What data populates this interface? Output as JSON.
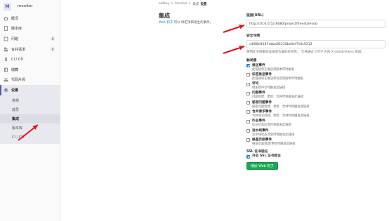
{
  "project": {
    "avatar_letter": "M",
    "name": "monitor"
  },
  "sidebar": {
    "items": [
      {
        "label": "概况",
        "icon": "home-icon"
      },
      {
        "label": "版本库",
        "icon": "doc-icon"
      },
      {
        "label": "问题",
        "icon": "issues-icon",
        "badge": "0"
      },
      {
        "label": "合并请求",
        "icon": "merge-request-icon",
        "badge": "0"
      },
      {
        "label": "CI / CD",
        "icon": "rocket-icon"
      },
      {
        "label": "储藏",
        "icon": "book-icon"
      },
      {
        "label": "代码片段",
        "icon": "scissors-icon"
      },
      {
        "label": "设置",
        "icon": "gear-icon"
      }
    ],
    "sub_items": [
      {
        "label": "常规"
      },
      {
        "label": "成员"
      },
      {
        "label": "集成"
      },
      {
        "label": "版本库"
      },
      {
        "label": "CI / CD"
      }
    ]
  },
  "breadcrumb": {
    "items": [
      "oldboy",
      "monitor",
      "集成"
    ],
    "separator": ">",
    "last": "设置"
  },
  "info": {
    "title": "集成",
    "desc_link": "Web 钩子",
    "desc_text": " 可以 绑定项目发生的事件。"
  },
  "form": {
    "url_label": "链接(URL)",
    "url_value": "http://10.0.0.52:8080/project/freestyle-job",
    "token_label": "安全令牌",
    "token_value": "c4f88d4187abba82230be0ef7e0c9213",
    "token_help": "使用此令牌来验证接收负载的有效性。 它将通过 HTTP 头的 X-Gitlab-Token 发送。",
    "trigger_label": "触发器",
    "events": [
      {
        "title": "推送事件",
        "desc": "此链接将在推送到版本库时触发",
        "checked": true
      },
      {
        "title": "标签推送事件",
        "desc": "此链接将在推送新标签到版本库时触发",
        "checked": false
      },
      {
        "title": "评论",
        "desc": "增加新评论时触发此链接",
        "checked": false
      },
      {
        "title": "问题事件",
        "desc": "问题创建、更新、合并时将触发此链接",
        "checked": false
      },
      {
        "title": "秘密问题事件",
        "desc": "秘密问题创建、更新、合并时将触发此链接",
        "checked": false
      },
      {
        "title": "合并请求事件",
        "desc": "合并请求创建、更新、合并时将触发此链接",
        "checked": false
      },
      {
        "title": "作业事件",
        "desc": "作业状态改变时将触发此链接",
        "checked": false
      },
      {
        "title": "流水线事件",
        "desc": "流水线状态改变时将触发此链接",
        "checked": false
      },
      {
        "title": "维基页面事件",
        "desc": "维基页面创建/更新时触发此链接",
        "checked": false
      }
    ],
    "ssl_label": "SSL 证书验证",
    "ssl_checkbox_label": "开启 SSL 证书验证",
    "ssl_checked": true,
    "submit_label": "增加 Web 钩子"
  },
  "colors": {
    "annotation_arrow": "#e8101a",
    "primary": "#1f78d1",
    "success": "#1aaa55"
  }
}
